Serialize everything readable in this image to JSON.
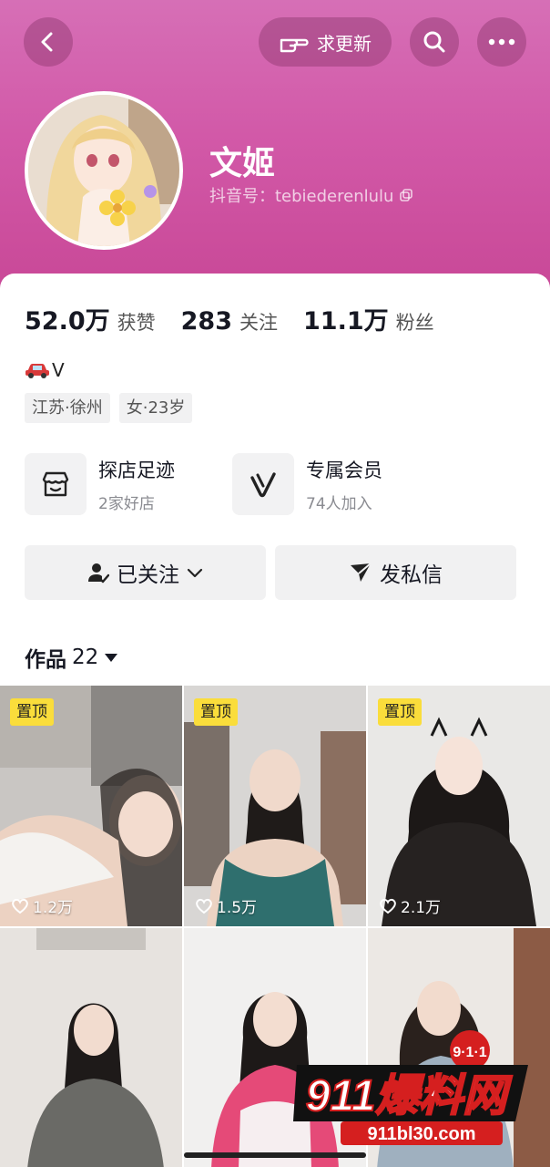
{
  "colors": {
    "header_top": "#d66fb6",
    "header_bottom": "#c84796",
    "pin_badge": "#fadd3b",
    "text_primary": "#161823"
  },
  "header": {
    "request_update_label": "求更新",
    "request_update_icon": "hand-point-icon",
    "back_icon": "chevron-left-icon",
    "search_icon": "search-icon",
    "more_icon": "more-dots-icon"
  },
  "profile": {
    "name": "文姬",
    "douyin_id": "抖音号：tebiederenlulu",
    "copy_icon": "copy-icon"
  },
  "stats": [
    {
      "num": "52.0万",
      "label": "获赞"
    },
    {
      "num": "283",
      "label": "关注"
    },
    {
      "num": "11.1万",
      "label": "粉丝"
    }
  ],
  "bio": {
    "text": "V",
    "icon": "car-icon"
  },
  "tags": [
    "江苏·徐州",
    "女·23岁"
  ],
  "features": [
    {
      "title": "探店足迹",
      "sub": "2家好店",
      "icon": "shop-icon"
    },
    {
      "title": "专属会员",
      "sub": "74人加入",
      "icon": "v-member-icon"
    }
  ],
  "actions": {
    "follow_label": "已关注",
    "message_label": "发私信"
  },
  "works": {
    "label": "作品",
    "count": "22"
  },
  "tiles": [
    {
      "pinned": true,
      "pin_label": "置顶",
      "likes": "1.2万"
    },
    {
      "pinned": true,
      "pin_label": "置顶",
      "likes": "1.5万"
    },
    {
      "pinned": true,
      "pin_label": "置顶",
      "likes": "2.1万"
    },
    {
      "pinned": false,
      "likes": ""
    },
    {
      "pinned": false,
      "likes": ""
    },
    {
      "pinned": false,
      "likes": ""
    }
  ],
  "watermark": {
    "brand": "911爆料网",
    "domain": "911bl30.com",
    "badge": "9·1·1"
  }
}
